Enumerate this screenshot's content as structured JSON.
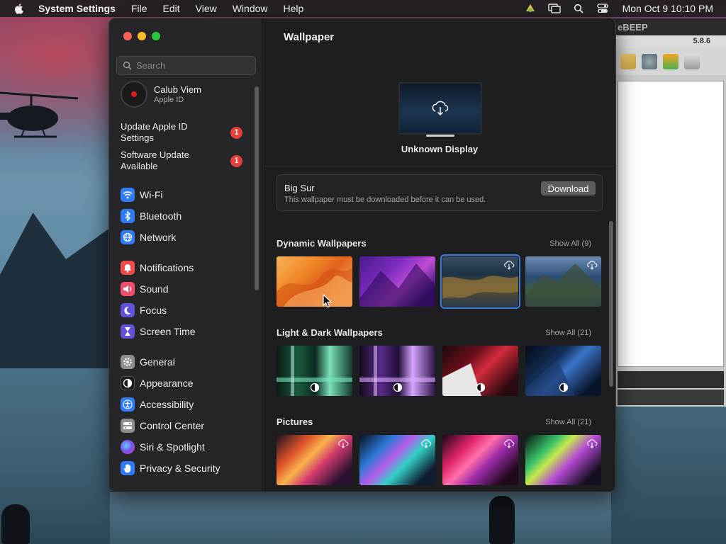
{
  "menubar": {
    "app_name": "System Settings",
    "menus": [
      "File",
      "Edit",
      "View",
      "Window",
      "Help"
    ],
    "clock": "Mon Oct 9  10:10 PM"
  },
  "background_app": {
    "title_fragment": "eBEEP",
    "version": "5.8.6"
  },
  "sidebar": {
    "search_placeholder": "Search",
    "account": {
      "name": "Calub Viem",
      "subtitle": "Apple ID"
    },
    "alerts": [
      {
        "label": "Update Apple ID Settings",
        "badge": "1"
      },
      {
        "label": "Software Update Available",
        "badge": "1"
      }
    ],
    "groups": [
      [
        {
          "label": "Wi-Fi",
          "icon": "wifi-icon",
          "color": "#2f7cf6"
        },
        {
          "label": "Bluetooth",
          "icon": "bluetooth-icon",
          "color": "#2f7cf6"
        },
        {
          "label": "Network",
          "icon": "globe-icon",
          "color": "#2f7cf6"
        }
      ],
      [
        {
          "label": "Notifications",
          "icon": "bell-icon",
          "color": "#ef4b4b"
        },
        {
          "label": "Sound",
          "icon": "speaker-icon",
          "color": "#ee4f6e"
        },
        {
          "label": "Focus",
          "icon": "moon-icon",
          "color": "#6151d8"
        },
        {
          "label": "Screen Time",
          "icon": "hourglass-icon",
          "color": "#6151d8"
        }
      ],
      [
        {
          "label": "General",
          "icon": "gear-icon",
          "color": "#8e8e93"
        },
        {
          "label": "Appearance",
          "icon": "appearance-icon",
          "color": "#1c1c1e"
        },
        {
          "label": "Accessibility",
          "icon": "accessibility-icon",
          "color": "#2f7cf6"
        },
        {
          "label": "Control Center",
          "icon": "control-center-icon",
          "color": "#8e8e93"
        },
        {
          "label": "Siri & Spotlight",
          "icon": "siri-icon",
          "color": "#b64bd8"
        },
        {
          "label": "Privacy & Security",
          "icon": "hand-icon",
          "color": "#2f7cf6"
        }
      ]
    ]
  },
  "content": {
    "title": "Wallpaper",
    "display_name": "Unknown Display",
    "download": {
      "name": "Big Sur",
      "message": "This wallpaper must be downloaded before it can be used.",
      "button": "Download"
    },
    "sections": [
      {
        "title": "Dynamic Wallpapers",
        "show_all": "Show All (9)"
      },
      {
        "title": "Light & Dark Wallpapers",
        "show_all": "Show All (21)"
      },
      {
        "title": "Pictures",
        "show_all": "Show All (21)"
      }
    ]
  },
  "colors": {
    "accent": "#3b7ddd",
    "badge": "#e8413c",
    "close": "#fe5f57",
    "minimize": "#febc2e",
    "zoom": "#28c840"
  }
}
